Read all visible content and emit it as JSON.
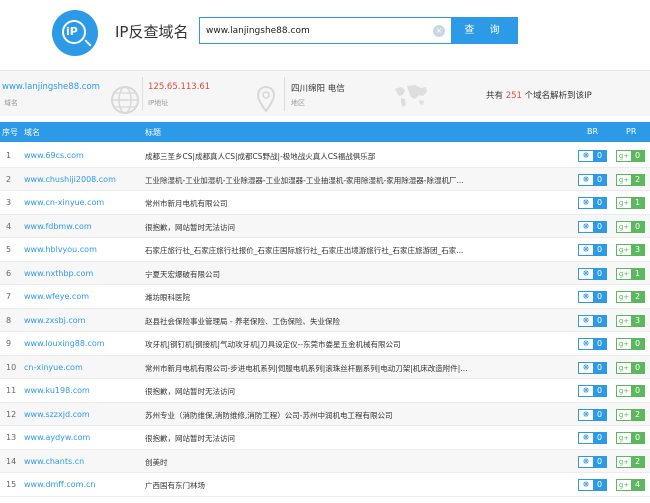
{
  "header": {
    "logo_text": "iP",
    "title": "IP反查域名",
    "search_value": "www.lanjingshe88.com",
    "search_button": "查 询"
  },
  "info": {
    "domain": "www.lanjingshe88.com",
    "domain_label": "域名",
    "ip": "125.65.113.61",
    "ip_label": "IP地址",
    "location": "四川绵阳 电信",
    "location_label": "地区",
    "count_prefix": "共有",
    "count": "251",
    "count_suffix": "个域名解析到该IP"
  },
  "table": {
    "headers": {
      "no": "序号",
      "domain": "域名",
      "title": "标题",
      "br": "BR",
      "pr": "PR"
    },
    "rows": [
      {
        "no": "1",
        "domain": "www.69cs.com",
        "title": "成都三圣乡CS|成都真人CS|成都CS野战|-极地战火真人CS福战俱乐部",
        "br": "0",
        "pr": "0"
      },
      {
        "no": "2",
        "domain": "www.chushiji2008.com",
        "title": "工业除湿机-工业加湿机-工业除湿器-工业加湿器-工业抽湿机-家用除湿机-家用除湿器-除湿机厂...",
        "br": "0",
        "pr": "2"
      },
      {
        "no": "3",
        "domain": "www.cn-xinyue.com",
        "title": "常州市新月电机有限公司",
        "br": "0",
        "pr": "1"
      },
      {
        "no": "4",
        "domain": "www.fdbmw.com",
        "title": "很抱歉，网站暂时无法访问",
        "br": "0",
        "pr": "0"
      },
      {
        "no": "5",
        "domain": "www.hblvyou.com",
        "title": "石家庄旅行社_石家庄旅行社报价_石家庄国际旅行社_石家庄出境游旅行社_石家庄旅游团_石家...",
        "br": "0",
        "pr": "3"
      },
      {
        "no": "6",
        "domain": "www.nxthbp.com",
        "title": "宁夏天宏爆破有限公司",
        "br": "0",
        "pr": "1"
      },
      {
        "no": "7",
        "domain": "www.wfeye.com",
        "title": "潍坊眼科医院",
        "br": "0",
        "pr": "2"
      },
      {
        "no": "8",
        "domain": "www.zxsbj.com",
        "title": "赵县社会保险事业管理局 - 养老保险、工伤保险、失业保险",
        "br": "0",
        "pr": "3"
      },
      {
        "no": "9",
        "domain": "www.louxing88.com",
        "title": "攻牙机|钢钉机|钢接机|气动攻牙机|刀具设定仪--东莞市娄星五金机械有限公司",
        "br": "0",
        "pr": "0"
      },
      {
        "no": "10",
        "domain": "cn-xinyue.com",
        "title": "常州市新月电机有限公司-步进电机系列|伺服电机系列|滚珠丝杆副系列|电动刀架|机床改造附件|...",
        "br": "0",
        "pr": "0"
      },
      {
        "no": "11",
        "domain": "www.ku198.com",
        "title": "很抱歉，网站暂时无法访问",
        "br": "0",
        "pr": "0"
      },
      {
        "no": "12",
        "domain": "www.szzxjd.com",
        "title": "苏州专业（消防维保,消防维修,消防工程）公司-苏州中润机电工程有限公司",
        "br": "0",
        "pr": "2"
      },
      {
        "no": "13",
        "domain": "www.aydyw.com",
        "title": "很抱歉，网站暂时无法访问",
        "br": "0",
        "pr": "0"
      },
      {
        "no": "14",
        "domain": "www.chants.cn",
        "title": "创美时",
        "br": "0",
        "pr": "2"
      },
      {
        "no": "15",
        "domain": "www.dmff.com.cn",
        "title": "广西国有东门林场",
        "br": "0",
        "pr": "4"
      }
    ]
  },
  "icons": {
    "br_icon": "paw-icon",
    "pr_icon": "g-plus-icon",
    "accent": "#2d9ae8",
    "pr_color": "#5cb85c",
    "highlight": "#e04a3a"
  }
}
